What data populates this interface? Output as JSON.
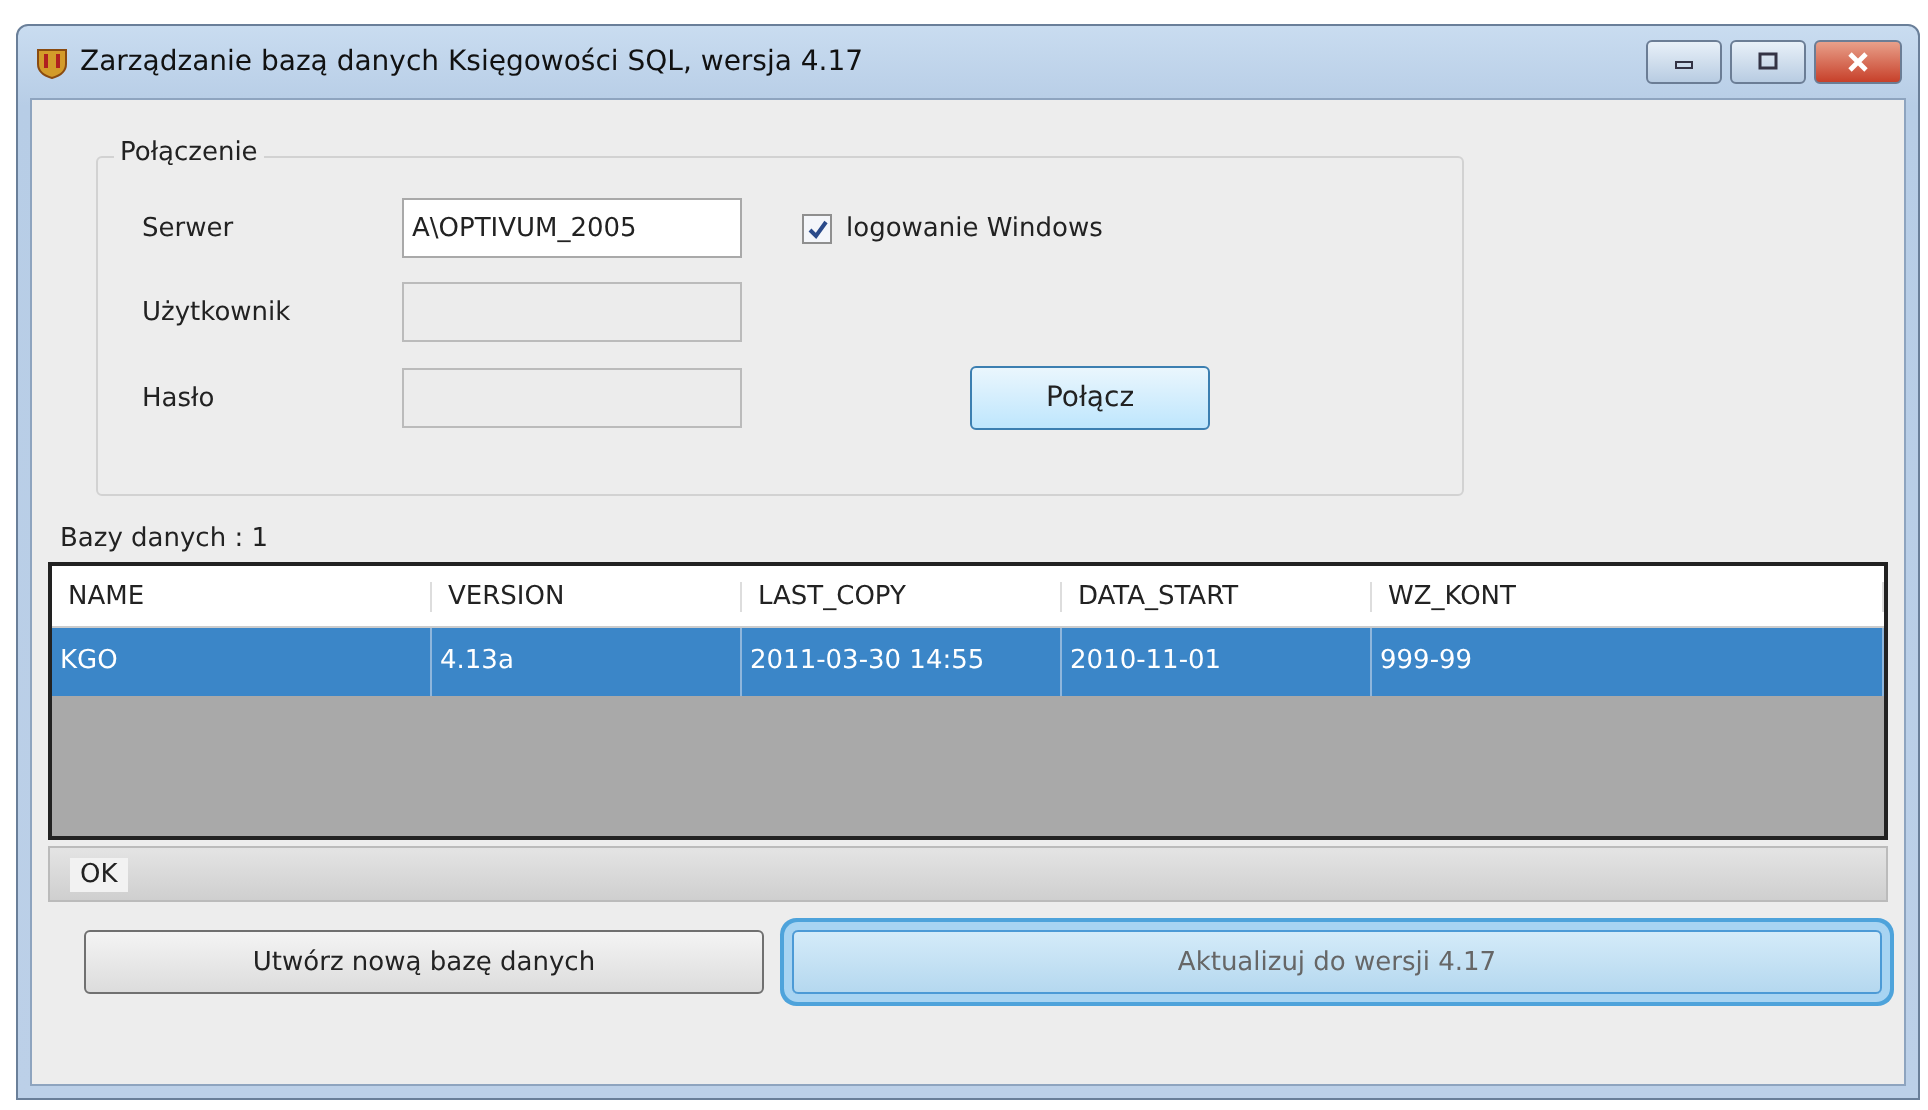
{
  "window": {
    "title": "Zarządzanie bazą danych Księgowości SQL, wersja 4.17"
  },
  "connection": {
    "title": "Połączenie",
    "fields": [
      {
        "label": "Serwer",
        "value": "A\\OPTIVUM_2005",
        "disabled": false
      },
      {
        "label": "Użytkownik",
        "disabled": true
      },
      {
        "label": "Hasło",
        "disabled": true
      }
    ],
    "windows_login": {
      "label": "logowanie Windows",
      "checked": true
    },
    "connect_button": "Połącz"
  },
  "databases_label": "Bazy danych : 1",
  "table": {
    "columns": [
      "NAME",
      "VERSION",
      "LAST_COPY",
      "DATA_START",
      "WZ_KONT"
    ],
    "rows": [
      {
        "cells": [
          "KGO",
          "4.13a",
          "2011-03-30 14:55",
          "2010-11-01",
          "999-99"
        ],
        "selected": true
      }
    ]
  },
  "status_bar": "OK",
  "buttons": [
    {
      "label": "Utwórz nową bazę danych",
      "highlighted": false
    },
    {
      "label": "Aktualizuj do wersji 4.17",
      "highlighted": true
    }
  ]
}
